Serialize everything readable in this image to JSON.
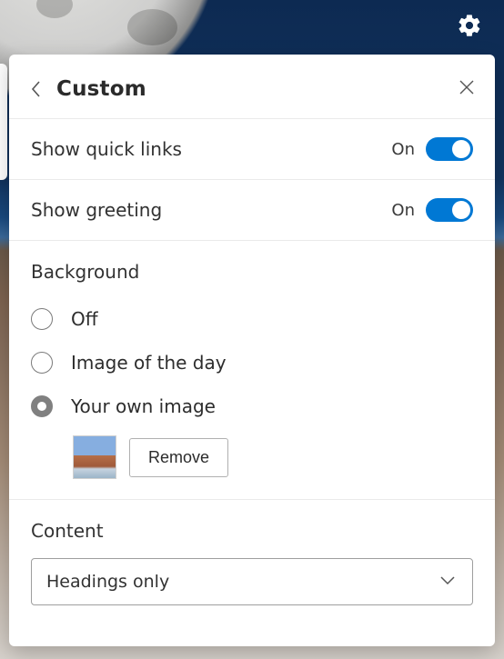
{
  "header": {
    "title": "Custom"
  },
  "toggles": {
    "quick_links": {
      "label": "Show quick links",
      "state_text": "On",
      "on": true
    },
    "greeting": {
      "label": "Show greeting",
      "state_text": "On",
      "on": true
    }
  },
  "background": {
    "title": "Background",
    "options": {
      "off": {
        "label": "Off",
        "selected": false
      },
      "daily": {
        "label": "Image of the day",
        "selected": false
      },
      "own": {
        "label": "Your own image",
        "selected": true
      }
    },
    "remove_label": "Remove"
  },
  "content": {
    "title": "Content",
    "selected_option": "Headings only"
  }
}
